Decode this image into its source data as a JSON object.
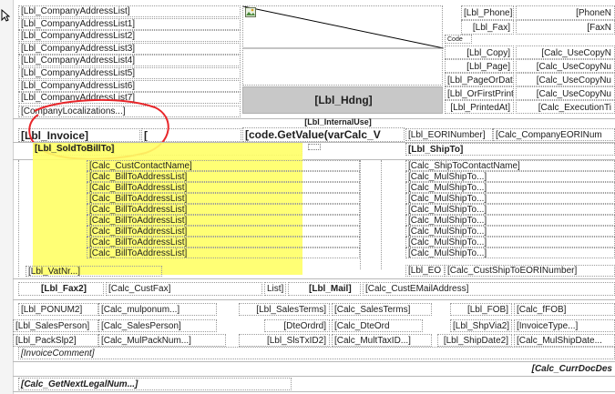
{
  "header": {
    "address_list": [
      "[Lbl_CompanyAddressList]",
      "[Lbl_CompanyAddressList1]",
      "[Lbl_CompanyAddressList2]",
      "[Lbl_CompanyAddressList3]",
      "[Lbl_CompanyAddressList4]",
      "[Lbl_CompanyAddressList5]",
      "[Lbl_CompanyAddressList6]",
      "[Lbl_CompanyAddressList7]"
    ],
    "company_localizations": "[CompanyLocalizations...]",
    "hdng": "[Lbl_Hdng]",
    "right_labels": [
      "[Lbl_Phone]",
      "[Lbl_Fax]",
      "[Lbl_Copy]",
      "[Lbl_Page]",
      "[Lbl_PageOrDate]",
      "[Lbl_OrFirstPrinted]",
      "[Lbl_PrintedAt]"
    ],
    "right_values": [
      "[PhoneN",
      "[FaxN",
      "[Calc_UseCopyN",
      "[Calc_UseCopyNu",
      "[Calc_UseCopyNu",
      "[Calc_UseCopyNu",
      "[Calc_ExecutionTi"
    ],
    "code_small": "Code"
  },
  "invoice": {
    "internal_use": "[Lbl_InternalUse]",
    "lbl_invoice": "[Lbl_Invoice]",
    "bracket": "[",
    "code_getvalue": "[code.GetValue(varCalc_V",
    "eori_number": "[Lbl_EORINumber]",
    "company_eori": "[Calc_CompanyEORINum",
    "sold_to": "[Lbl_SoldToBillTo]",
    "ship_to": "[Lbl_ShipTo]"
  },
  "billto": {
    "contact": "[Calc_CustContactName]",
    "lines": [
      "[Calc_BillToAddressList]",
      "[Calc_BillToAddressList]",
      "[Calc_BillToAddressList]",
      "[Calc_BillToAddressList]",
      "[Calc_BillToAddressList]",
      "[Calc_BillToAddressList]",
      "[Calc_BillToAddressList]",
      "[Calc_BillToAddressList]"
    ],
    "vat": "[Lbl_VatNr...]"
  },
  "shipto": {
    "contact": "[Calc_ShipToContactName]",
    "lines": [
      "[Calc_MulShipTo...]",
      "[Calc_MulShipTo...]",
      "[Calc_MulShipTo...]",
      "[Calc_MulShipTo...]",
      "[Calc_MulShipTo...]",
      "[Calc_MulShipTo...]",
      "[Calc_MulShipTo...]",
      "[Calc_MulShipTo...]"
    ],
    "lbl_eori": "[Lbl_EO",
    "eori": "[Calc_CustShipToEORINumber]"
  },
  "contact_row": {
    "lbl_fax2": "[Lbl_Fax2]",
    "cust_fax": "[Calc_CustFax]",
    "list": "List]",
    "lbl_mail": "[Lbl_Mail]",
    "cust_email": "[Calc_CustEMailAddress]"
  },
  "detail_rows": {
    "row1": [
      "[Lbl_PONUM2]",
      "[Calc_mulponum...]",
      "[Lbl_SalesTerms]",
      "[Calc_SalesTerms]",
      "[Lbl_FOB]",
      "[Calc_fFOB]"
    ],
    "row2": [
      "[Lbl_SalesPerson]",
      "[Calc_SalesPerson]",
      "[DteOrdrd]",
      "[Calc_DteOrd",
      "[Lbl_ShpVia2]",
      "[InvoiceType...]"
    ],
    "row3": [
      "[Lbl_PackSlp2]",
      "[Calc_MulPackNum...]",
      "[Lbl_SlsTxID2]",
      "[Calc_MultTaxID...]",
      "[Lbl_ShipDate2]",
      "[Calc_MulShipDate..."
    ]
  },
  "footer": {
    "invoice_comment": "[InvoiceComment]",
    "curr_doc": "[Calc_CurrDocDes",
    "next_legal": "[Calc_GetNextLegalNum...]"
  },
  "colors": {
    "highlight": "#ffff66",
    "annotation_red": "#e8262a",
    "hdng_bg": "#c8c8c8"
  }
}
